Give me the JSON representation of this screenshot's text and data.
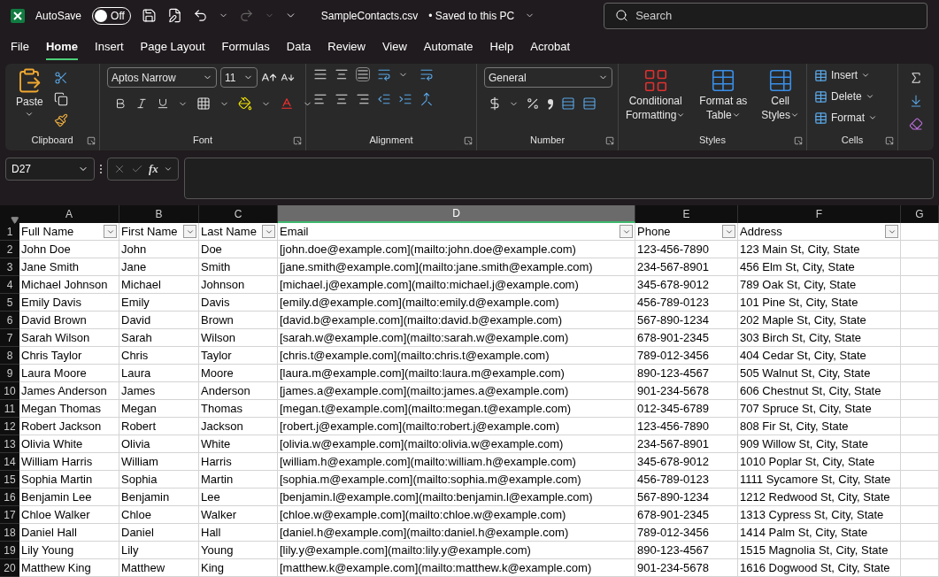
{
  "title_bar": {
    "autosave_label": "AutoSave",
    "autosave": {
      "on": false,
      "label": "Off"
    },
    "file_name": "SampleContacts.csv",
    "save_status": "• Saved to this PC",
    "search": {
      "placeholder": "Search"
    }
  },
  "menu_tabs": [
    {
      "label": "File",
      "selected": false
    },
    {
      "label": "Home",
      "selected": true
    },
    {
      "label": "Insert",
      "selected": false
    },
    {
      "label": "Page Layout",
      "selected": false
    },
    {
      "label": "Formulas",
      "selected": false
    },
    {
      "label": "Data",
      "selected": false
    },
    {
      "label": "Review",
      "selected": false
    },
    {
      "label": "View",
      "selected": false
    },
    {
      "label": "Automate",
      "selected": false
    },
    {
      "label": "Help",
      "selected": false
    },
    {
      "label": "Acrobat",
      "selected": false
    }
  ],
  "ribbon": {
    "clipboard": {
      "paste": "Paste",
      "label": "Clipboard"
    },
    "font": {
      "name": "Aptos Narrow",
      "size": "11",
      "label": "Font"
    },
    "alignment": {
      "label": "Alignment"
    },
    "number": {
      "format": "General",
      "label": "Number"
    },
    "styles": {
      "buttons": [
        [
          "Conditional",
          "Formatting"
        ],
        [
          "Format as",
          "Table"
        ],
        [
          "Cell",
          "Styles"
        ]
      ],
      "label": "Styles"
    },
    "cells": {
      "buttons": [
        "Insert",
        "Delete",
        "Format"
      ],
      "label": "Cells"
    }
  },
  "formula_bar": {
    "name_box": "D27",
    "fx": "fx"
  },
  "sheet": {
    "columns": [
      {
        "letter": "A",
        "selected": false
      },
      {
        "letter": "B",
        "selected": false
      },
      {
        "letter": "C",
        "selected": false
      },
      {
        "letter": "D",
        "selected": true
      },
      {
        "letter": "E",
        "selected": false
      },
      {
        "letter": "F",
        "selected": false
      },
      {
        "letter": "G",
        "selected": false
      }
    ],
    "header_row": {
      "number": "1",
      "cells": [
        "Full Name",
        "First Name",
        "Last Name",
        "Email",
        "Phone",
        "Address"
      ]
    },
    "rows": [
      {
        "number": "2",
        "cells": [
          "John Doe",
          "John",
          "Doe",
          "[john.doe@example.com](mailto:john.doe@example.com)",
          "123-456-7890",
          "123 Main St, City, State"
        ]
      },
      {
        "number": "3",
        "cells": [
          "Jane Smith",
          "Jane",
          "Smith",
          "[jane.smith@example.com](mailto:jane.smith@example.com)",
          "234-567-8901",
          "456 Elm St, City, State"
        ]
      },
      {
        "number": "4",
        "cells": [
          "Michael Johnson",
          "Michael",
          "Johnson",
          "[michael.j@example.com](mailto:michael.j@example.com)",
          "345-678-9012",
          "789 Oak St, City, State"
        ]
      },
      {
        "number": "5",
        "cells": [
          "Emily Davis",
          "Emily",
          "Davis",
          "[emily.d@example.com](mailto:emily.d@example.com)",
          "456-789-0123",
          "101 Pine St, City, State"
        ]
      },
      {
        "number": "6",
        "cells": [
          "David Brown",
          "David",
          "Brown",
          "[david.b@example.com](mailto:david.b@example.com)",
          "567-890-1234",
          "202 Maple St, City, State"
        ]
      },
      {
        "number": "7",
        "cells": [
          "Sarah Wilson",
          "Sarah",
          "Wilson",
          "[sarah.w@example.com](mailto:sarah.w@example.com)",
          "678-901-2345",
          "303 Birch St, City, State"
        ]
      },
      {
        "number": "8",
        "cells": [
          "Chris Taylor",
          "Chris",
          "Taylor",
          "[chris.t@example.com](mailto:chris.t@example.com)",
          "789-012-3456",
          "404 Cedar St, City, State"
        ]
      },
      {
        "number": "9",
        "cells": [
          "Laura Moore",
          "Laura",
          "Moore",
          "[laura.m@example.com](mailto:laura.m@example.com)",
          "890-123-4567",
          "505 Walnut St, City, State"
        ]
      },
      {
        "number": "10",
        "cells": [
          "James Anderson",
          "James",
          "Anderson",
          "[james.a@example.com](mailto:james.a@example.com)",
          "901-234-5678",
          "606 Chestnut St, City, State"
        ]
      },
      {
        "number": "11",
        "cells": [
          "Megan Thomas",
          "Megan",
          "Thomas",
          "[megan.t@example.com](mailto:megan.t@example.com)",
          "012-345-6789",
          "707 Spruce St, City, State"
        ]
      },
      {
        "number": "12",
        "cells": [
          "Robert Jackson",
          "Robert",
          "Jackson",
          "[robert.j@example.com](mailto:robert.j@example.com)",
          "123-456-7890",
          "808 Fir St, City, State"
        ]
      },
      {
        "number": "13",
        "cells": [
          "Olivia White",
          "Olivia",
          "White",
          "[olivia.w@example.com](mailto:olivia.w@example.com)",
          "234-567-8901",
          "909 Willow St, City, State"
        ]
      },
      {
        "number": "14",
        "cells": [
          "William Harris",
          "William",
          "Harris",
          "[william.h@example.com](mailto:william.h@example.com)",
          "345-678-9012",
          "1010 Poplar St, City, State"
        ]
      },
      {
        "number": "15",
        "cells": [
          "Sophia Martin",
          "Sophia",
          "Martin",
          "[sophia.m@example.com](mailto:sophia.m@example.com)",
          "456-789-0123",
          "1111 Sycamore St, City, State"
        ]
      },
      {
        "number": "16",
        "cells": [
          "Benjamin Lee",
          "Benjamin",
          "Lee",
          "[benjamin.l@example.com](mailto:benjamin.l@example.com)",
          "567-890-1234",
          "1212 Redwood St, City, State"
        ]
      },
      {
        "number": "17",
        "cells": [
          "Chloe Walker",
          "Chloe",
          "Walker",
          "[chloe.w@example.com](mailto:chloe.w@example.com)",
          "678-901-2345",
          "1313 Cypress St, City, State"
        ]
      },
      {
        "number": "18",
        "cells": [
          "Daniel Hall",
          "Daniel",
          "Hall",
          "[daniel.h@example.com](mailto:daniel.h@example.com)",
          "789-012-3456",
          "1414 Palm St, City, State"
        ]
      },
      {
        "number": "19",
        "cells": [
          "Lily Young",
          "Lily",
          "Young",
          "[lily.y@example.com](mailto:lily.y@example.com)",
          "890-123-4567",
          "1515 Magnolia St, City, State"
        ]
      },
      {
        "number": "20",
        "cells": [
          "Matthew King",
          "Matthew",
          "King",
          "[matthew.k@example.com](mailto:matthew.k@example.com)",
          "901-234-5678",
          "1616 Dogwood St, City, State"
        ]
      }
    ]
  }
}
